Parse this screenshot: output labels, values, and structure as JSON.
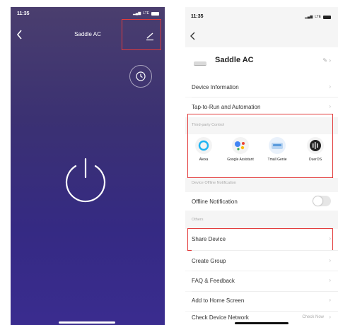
{
  "left": {
    "status_time": "11:35",
    "status_net": "LTE",
    "title": "Saddle AC"
  },
  "right": {
    "status_time": "11:35",
    "status_net": "LTE",
    "device_name": "Saddle AC",
    "menu": {
      "device_info": "Device Information",
      "tap_to_run": "Tap-to-Run and Automation"
    },
    "third_party": {
      "section_label": "Third-party Control",
      "items": [
        {
          "label": "Alexa",
          "icon": "alexa-icon"
        },
        {
          "label": "Google Assistant",
          "icon": "google-assistant-icon"
        },
        {
          "label": "Tmall Genie",
          "icon": "tmall-genie-icon"
        },
        {
          "label": "DuerOS",
          "icon": "dueros-icon"
        }
      ]
    },
    "offline": {
      "section_label": "Device Offline Notification",
      "label": "Offline Notification",
      "toggle_on": false
    },
    "others": {
      "section_label": "Others",
      "share": "Share Device",
      "create_group": "Create Group",
      "faq": "FAQ & Feedback",
      "home_screen": "Add to Home Screen",
      "network": "Check Device Network",
      "network_action": "Check Now"
    }
  },
  "colors": {
    "highlight": "#e23b3b",
    "left_bg_top": "#4a3e6e",
    "left_bg_bottom": "#3a2c8f"
  }
}
